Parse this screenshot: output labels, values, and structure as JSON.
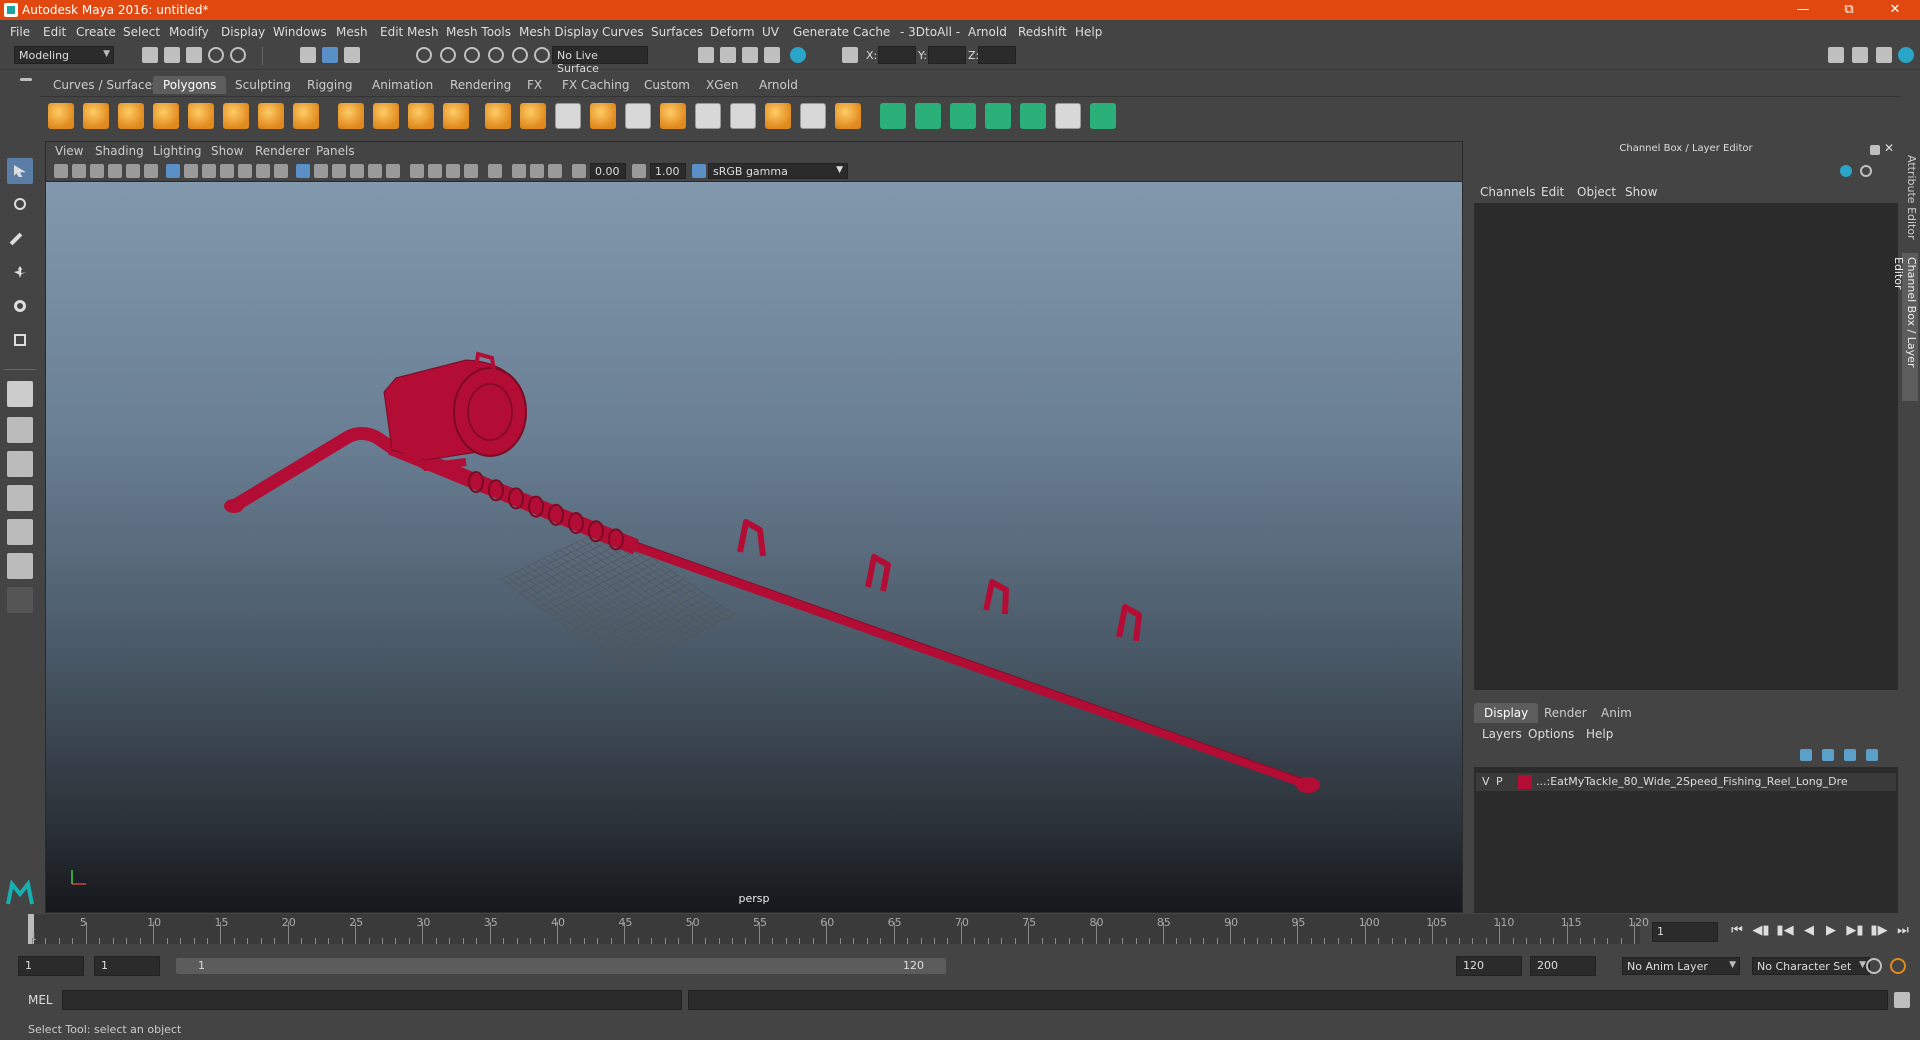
{
  "window": {
    "title": "Autodesk Maya 2016: untitled*"
  },
  "menubar": [
    "File",
    "Edit",
    "Create",
    "Select",
    "Modify",
    "Display",
    "Windows",
    "Mesh",
    "Edit Mesh",
    "Mesh Tools",
    "Mesh Display",
    "Curves",
    "Surfaces",
    "Deform",
    "UV",
    "Generate",
    "Cache",
    "- 3DtoAll -",
    "Arnold",
    "Redshift",
    "Help"
  ],
  "statusline": {
    "mode": "Modeling",
    "live_surface": "No Live Surface",
    "x_label": "X:",
    "y_label": "Y:",
    "z_label": "Z:"
  },
  "shelf_tabs": [
    "Curves / Surfaces",
    "Polygons",
    "Sculpting",
    "Rigging",
    "Animation",
    "Rendering",
    "FX",
    "FX Caching",
    "Custom",
    "XGen",
    "Arnold"
  ],
  "shelf_active": "Polygons",
  "viewport": {
    "menu": [
      "View",
      "Shading",
      "Lighting",
      "Show",
      "Renderer",
      "Panels"
    ],
    "exposure": "0.00",
    "gamma": "1.00",
    "color_space": "sRGB gamma",
    "camera": "persp",
    "model_color": "#b30d35"
  },
  "channel_box": {
    "title": "Channel Box / Layer Editor",
    "menu": [
      "Channels",
      "Edit",
      "Object",
      "Show"
    ]
  },
  "layer_editor": {
    "tabs": [
      "Display",
      "Render",
      "Anim"
    ],
    "active_tab": "Display",
    "menu": [
      "Layers",
      "Options",
      "Help"
    ],
    "layer": {
      "v": "V",
      "p": "P",
      "name": "...:EatMyTackle_80_Wide_2Speed_Fishing_Reel_Long_Dre",
      "color": "#b30d35"
    }
  },
  "side_tabs": [
    "Attribute Editor",
    "Channel Box / Layer Editor"
  ],
  "timeline": {
    "labels": [
      "5",
      "10",
      "15",
      "20",
      "25",
      "30",
      "35",
      "40",
      "45",
      "50",
      "55",
      "60",
      "65",
      "70",
      "75",
      "80",
      "85",
      "90",
      "95",
      "100",
      "105",
      "110",
      "115",
      "120"
    ],
    "start_label": "1",
    "current_frame": "1"
  },
  "range": {
    "start": "1",
    "anim_start": "1",
    "slider_start": "1",
    "slider_end": "120",
    "end": "120",
    "anim_end": "200",
    "anim_layer": "No Anim Layer",
    "character_set": "No Character Set"
  },
  "command": {
    "label": "MEL"
  },
  "help_line": "Select Tool: select an object"
}
